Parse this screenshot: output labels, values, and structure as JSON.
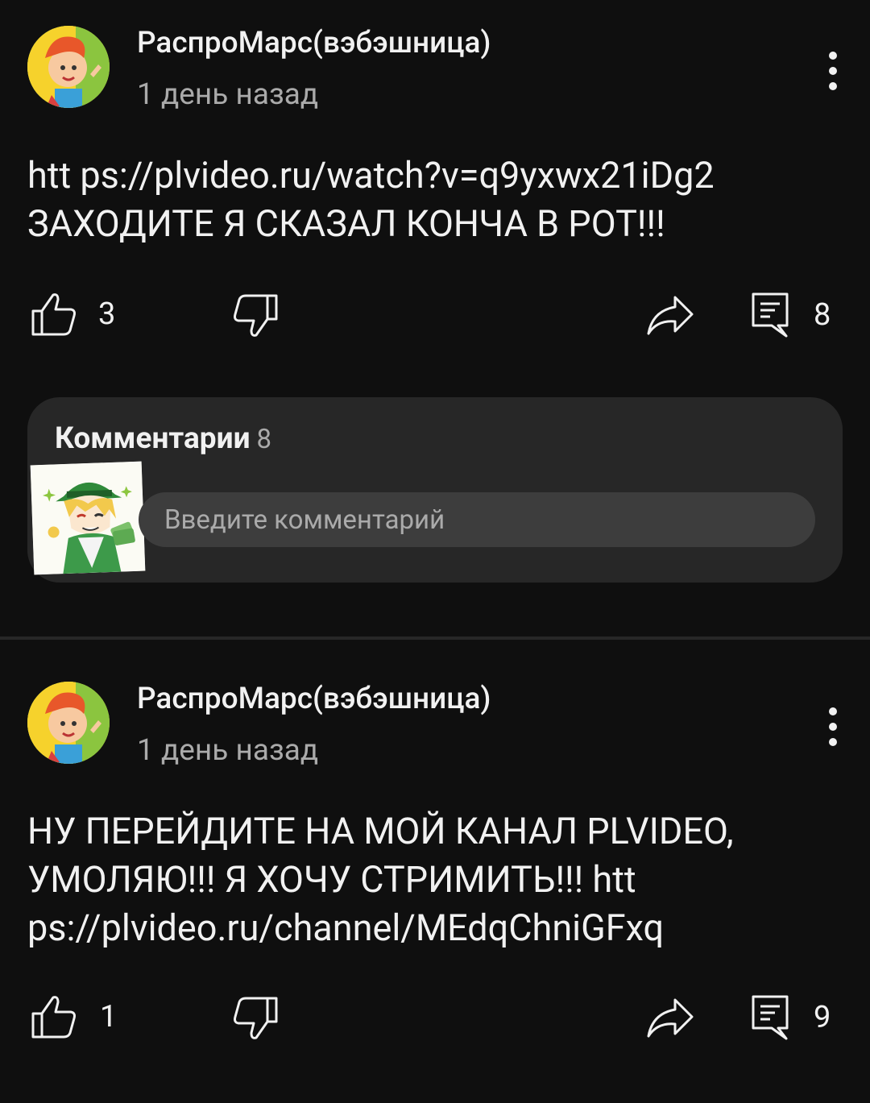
{
  "posts": [
    {
      "author": "РаспроМарс(вэбэшница)",
      "time": "1 день назад",
      "text_lines": [
        "htt ps://plvideo.ru/watch?v=q9yxwx21iDg2",
        "ЗАХОДИТЕ Я СКАЗАЛ КОНЧА В РОТ!!!"
      ],
      "likes": "3",
      "comments": "8"
    },
    {
      "author": "РаспроМарс(вэбэшница)",
      "time": "1 день назад",
      "text_lines": [
        "НУ ПЕРЕЙДИТЕ НА МОЙ КАНАЛ PLVIDEO,",
        "УМОЛЯЮ!!! Я ХОЧУ СТРИМИТЬ!!! htt",
        "ps://plvideo.ru/channel/MEdqChniGFxq"
      ],
      "likes": "1",
      "comments": "9"
    }
  ],
  "comments_section": {
    "title": "Комментарии",
    "count": "8",
    "input_placeholder": "Введите комментарий"
  },
  "icons": {
    "like": "thumb-up-icon",
    "dislike": "thumb-down-icon",
    "share": "share-arrow-icon",
    "comments": "comment-icon",
    "menu": "more-vertical-icon"
  },
  "colors": {
    "background": "#0f0f0f",
    "card": "#272727",
    "input": "#3d3d3d",
    "text_primary": "#f1f1f1",
    "text_secondary": "#aaaaaa"
  }
}
